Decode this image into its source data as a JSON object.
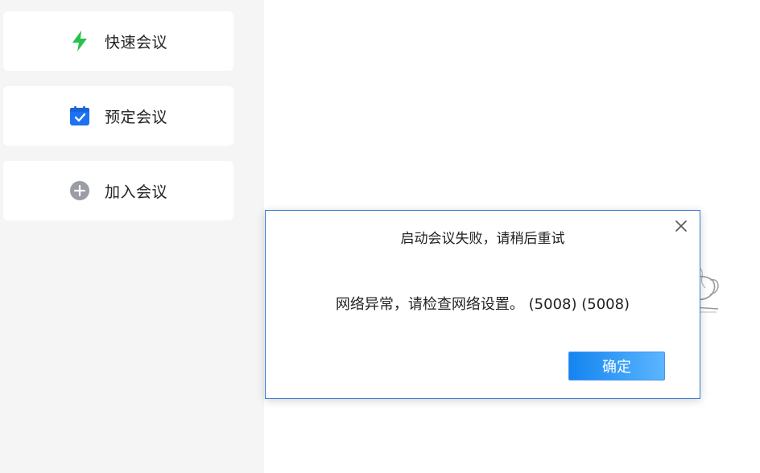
{
  "sidebar": {
    "actions": [
      {
        "label": "快速会议",
        "icon": "lightning-icon",
        "icon_color": "#27c24c"
      },
      {
        "label": "预定会议",
        "icon": "calendar-check-icon",
        "icon_color": "#1d72f3"
      },
      {
        "label": "加入会议",
        "icon": "plus-circle-icon",
        "icon_color": "#9a9da3"
      }
    ]
  },
  "dialog": {
    "title": "启动会议失败，请稍后重试",
    "message": "网络异常，请检查网络设置。 (5008) (5008)",
    "confirm_label": "确定",
    "close_icon": "close-icon",
    "border_color": "#3a7bd5",
    "button_color": "#1484f0"
  }
}
